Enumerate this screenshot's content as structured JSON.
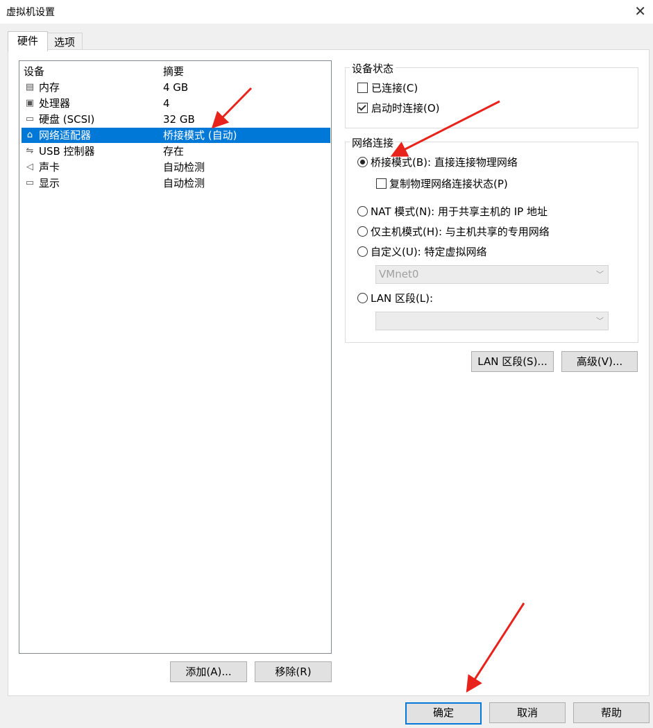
{
  "window": {
    "title": "虚拟机设置",
    "close_glyph": "✕"
  },
  "tabs": [
    {
      "label": "硬件"
    },
    {
      "label": "选项"
    }
  ],
  "device_list": {
    "col_device": "设备",
    "col_summary": "摘要",
    "rows": [
      {
        "name": "内存",
        "summary": "4 GB",
        "icon": "memory-icon",
        "glyph": "▤"
      },
      {
        "name": "处理器",
        "summary": "4",
        "icon": "processor-icon",
        "glyph": "▣"
      },
      {
        "name": "硬盘 (SCSI)",
        "summary": "32 GB",
        "icon": "hard-disk-icon",
        "glyph": "▭"
      },
      {
        "name": "网络适配器",
        "summary": "桥接模式 (自动)",
        "icon": "network-adapter-icon",
        "glyph": "⌂",
        "selected": true
      },
      {
        "name": "USB 控制器",
        "summary": "存在",
        "icon": "usb-icon",
        "glyph": "⇋"
      },
      {
        "name": "声卡",
        "summary": "自动检测",
        "icon": "sound-icon",
        "glyph": "◁"
      },
      {
        "name": "显示",
        "summary": "自动检测",
        "icon": "display-icon",
        "glyph": "▭"
      }
    ],
    "add_label": "添加(A)...",
    "remove_label": "移除(R)"
  },
  "device_status": {
    "title": "设备状态",
    "connected": {
      "label": "已连接(C)",
      "checked": false
    },
    "connect_on_power": {
      "label": "启动时连接(O)",
      "checked": true
    }
  },
  "network_connection": {
    "title": "网络连接",
    "bridged": {
      "label": "桥接模式(B): 直接连接物理网络",
      "selected": true
    },
    "replicate": {
      "label": "复制物理网络连接状态(P)",
      "checked": false
    },
    "nat": {
      "label": "NAT 模式(N): 用于共享主机的 IP 地址",
      "selected": false
    },
    "host_only": {
      "label": "仅主机模式(H): 与主机共享的专用网络",
      "selected": false
    },
    "custom": {
      "label": "自定义(U): 特定虚拟网络",
      "selected": false
    },
    "custom_select": {
      "value": "VMnet0"
    },
    "lan": {
      "label": "LAN 区段(L):",
      "selected": false
    },
    "lan_select": {
      "value": ""
    }
  },
  "right_buttons": {
    "lan_segments": "LAN 区段(S)...",
    "advanced": "高级(V)..."
  },
  "footer": {
    "ok": "确定",
    "cancel": "取消",
    "help": "帮助"
  },
  "colors": {
    "selection": "#0078d7",
    "annotation_arrow": "#e8231c"
  }
}
